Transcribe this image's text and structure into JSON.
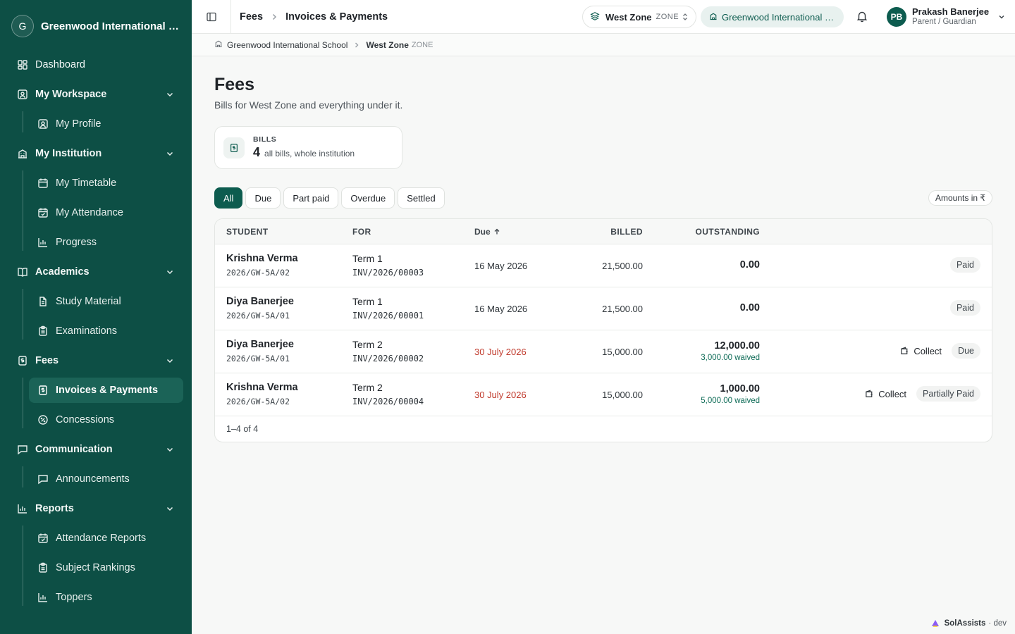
{
  "sidebar": {
    "brand_initial": "G",
    "brand_name": "Greenwood International School",
    "dashboard": "Dashboard",
    "my_workspace": "My Workspace",
    "my_profile": "My Profile",
    "my_institution": "My Institution",
    "my_timetable": "My Timetable",
    "my_attendance": "My Attendance",
    "progress": "Progress",
    "academics": "Academics",
    "study_material": "Study Material",
    "examinations": "Examinations",
    "fees": "Fees",
    "invoices_payments": "Invoices & Payments",
    "concessions": "Concessions",
    "communication": "Communication",
    "announcements": "Announcements",
    "reports": "Reports",
    "attendance_reports": "Attendance Reports",
    "subject_rankings": "Subject Rankings",
    "toppers": "Toppers"
  },
  "topbar": {
    "crumb_1": "Fees",
    "crumb_2": "Invoices & Payments",
    "zone_name": "West Zone",
    "zone_tag": "ZONE",
    "school_pill": "Greenwood International School",
    "user_initials": "PB",
    "user_name": "Prakash Banerjee",
    "user_role": "Parent / Guardian"
  },
  "subcrumb": {
    "school": "Greenwood International School",
    "zone": "West Zone",
    "zone_tag": "ZONE"
  },
  "page": {
    "title": "Fees",
    "subtitle": "Bills for West Zone and everything under it."
  },
  "stat": {
    "label": "BILLS",
    "count": "4",
    "desc": "all bills, whole institution"
  },
  "filters": {
    "all": "All",
    "due": "Due",
    "part_paid": "Part paid",
    "overdue": "Overdue",
    "settled": "Settled",
    "amounts": "Amounts in ₹"
  },
  "table": {
    "headers": {
      "student": "STUDENT",
      "for": "FOR",
      "due": "Due",
      "billed": "BILLED",
      "outstanding": "OUTSTANDING"
    },
    "rows": [
      {
        "name": "Krishna Verma",
        "roll": "2026/GW-5A/02",
        "term": "Term 1",
        "invoice": "INV/2026/00003",
        "due": "16 May 2026",
        "billed": "21,500.00",
        "outstanding": "0.00",
        "waived": "",
        "collect": "",
        "status": "Paid"
      },
      {
        "name": "Diya Banerjee",
        "roll": "2026/GW-5A/01",
        "term": "Term 1",
        "invoice": "INV/2026/00001",
        "due": "16 May 2026",
        "billed": "21,500.00",
        "outstanding": "0.00",
        "waived": "",
        "collect": "",
        "status": "Paid"
      },
      {
        "name": "Diya Banerjee",
        "roll": "2026/GW-5A/01",
        "term": "Term 2",
        "invoice": "INV/2026/00002",
        "due": "30 July 2026",
        "billed": "15,000.00",
        "outstanding": "12,000.00",
        "waived": "3,000.00 waived",
        "collect": "Collect",
        "status": "Due"
      },
      {
        "name": "Krishna Verma",
        "roll": "2026/GW-5A/02",
        "term": "Term 2",
        "invoice": "INV/2026/00004",
        "due": "30 July 2026",
        "billed": "15,000.00",
        "outstanding": "1,000.00",
        "waived": "5,000.00 waived",
        "collect": "Collect",
        "status": "Partially Paid"
      }
    ],
    "footer": "1–4 of 4"
  },
  "footer": {
    "brand": "SolAssists",
    "env": "· dev"
  },
  "colors": {
    "sidebar_bg": "#0d4f45",
    "accent": "#0d5c4f",
    "overdue": "#c0392b",
    "waived": "#0d6b56"
  }
}
